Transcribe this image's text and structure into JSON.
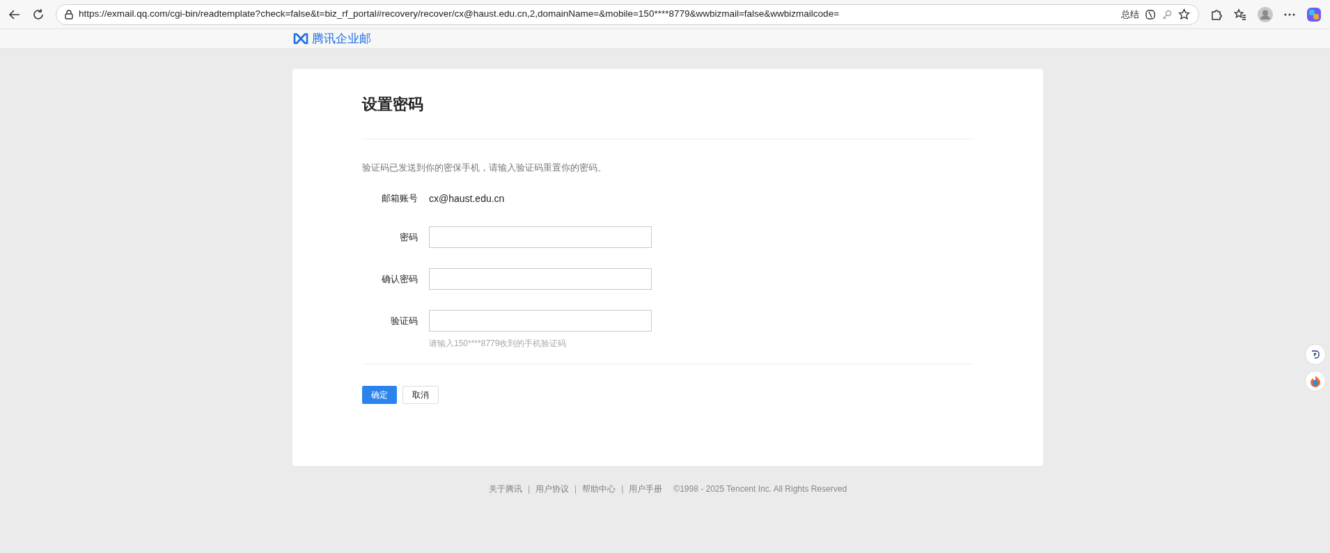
{
  "browser": {
    "url": "https://exmail.qq.com/cgi-bin/readtemplate?check=false&t=biz_rf_portal#recovery/recover/cx@haust.edu.cn,2,domainName=&mobile=150****8779&wwbizmail=false&wwbizmailcode=",
    "summary_button": "总结"
  },
  "header": {
    "logo_text": "腾讯企业邮"
  },
  "card": {
    "title": "设置密码",
    "description": "验证码已发送到你的密保手机，请输入验证码重置你的密码。",
    "account": {
      "label": "邮箱账号",
      "value": "cx@haust.edu.cn"
    },
    "fields": [
      {
        "label": "密码"
      },
      {
        "label": "确认密码"
      },
      {
        "label": "验证码",
        "hint": "请输入150****8779收到的手机验证码"
      }
    ],
    "buttons": [
      {
        "kind": "primary",
        "label": "确定"
      },
      {
        "kind": "secondary",
        "label": "取消"
      }
    ]
  },
  "footer": {
    "items": [
      {
        "kind": "link",
        "text": "关于腾讯"
      },
      {
        "kind": "separator",
        "text": "|"
      },
      {
        "kind": "link",
        "text": "用户协议"
      },
      {
        "kind": "separator",
        "text": "|"
      },
      {
        "kind": "link",
        "text": "帮助中心"
      },
      {
        "kind": "separator",
        "text": "|"
      },
      {
        "kind": "link",
        "text": "用户手册"
      }
    ],
    "copyright": "©1998 - 2025 Tencent Inc. All Rights Reserved"
  }
}
